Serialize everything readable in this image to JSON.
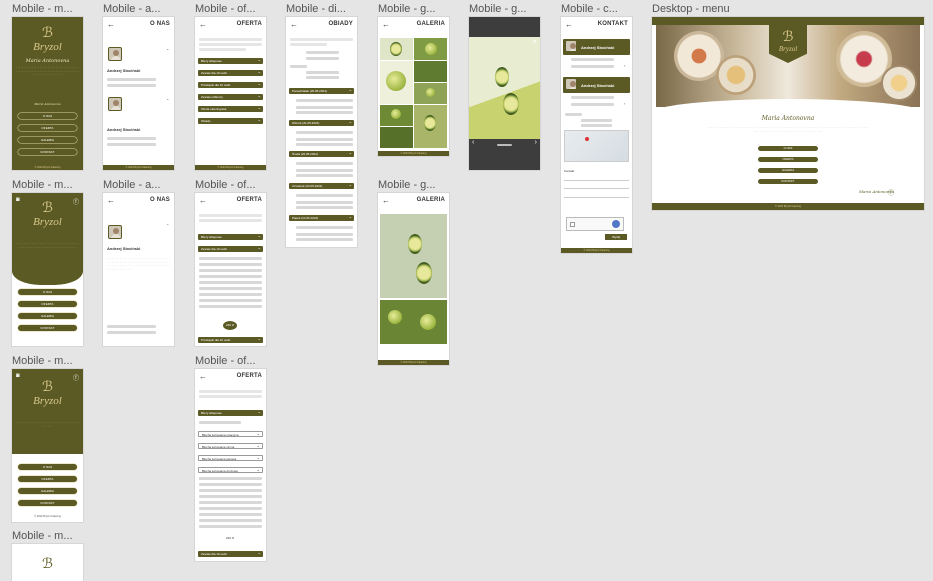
{
  "labels": {
    "c1a": "Mobile - m...",
    "c1b": "Mobile - m...",
    "c1c": "Mobile - m...",
    "c1d": "Mobile - m...",
    "c2a": "Mobile - a...",
    "c2b": "Mobile - a...",
    "c3a": "Mobile - of...",
    "c3b": "Mobile - of...",
    "c3c": "Mobile - of...",
    "c4a": "Mobile - di...",
    "c5a": "Mobile - g...",
    "c5b": "Mobile - g...",
    "c6a": "Mobile - g...",
    "c7a": "Mobile - c...",
    "desktop": "Desktop - menu"
  },
  "brand": {
    "monogram": "ℬ",
    "name": "Bryzol",
    "signature": "Maria Antonovna"
  },
  "menu": [
    "O NAS",
    "OFERTA",
    "GALERIA",
    "KONTAKT"
  ],
  "pages": {
    "onas": "O NAS",
    "oferta": "OFERTA",
    "obiady": "OBIADY",
    "galeria": "GALERIA",
    "kontakt": "KONTAKT"
  },
  "people": [
    "Andrzej Słociński",
    "Andrzej Słociński"
  ],
  "oferta_sections": [
    "Bluzy sklepowe",
    "Zestaw dla 10 osób",
    "Przekąski dla 10 osób",
    "Zestaw odbiorcy",
    "Oferta cateringowa",
    "Obiady"
  ],
  "oferta_b_sections": [
    "Bluzy sklepowe",
    "Zestaw dla 10 osób",
    "Przekąski dla 10 osób"
  ],
  "oferta_c_sections": [
    "Bluzy sklepowe",
    "Błocha kotowania rotacyjna",
    "Błocha kotowania zimna",
    "Błocha kotowania jasiowa",
    "Błocha kotowania drożowa",
    "Zestaw dla 10 osób"
  ],
  "price": "240 zł",
  "obiady_days": [
    "Poniedziałek (20.05.2024)",
    "Wtorek (21.05.2024)",
    "Środa (22.05.2024)",
    "Czwartek (23.05.2024)",
    "Piątek (24.05.2024)"
  ],
  "contact_label": "Kontakt",
  "send": "Wyślij",
  "footer": "© 2024 Bryzol Catering",
  "colors": {
    "olive": "#5c5a24",
    "gold": "#d9c98a",
    "canvas": "#e5e5e5"
  }
}
